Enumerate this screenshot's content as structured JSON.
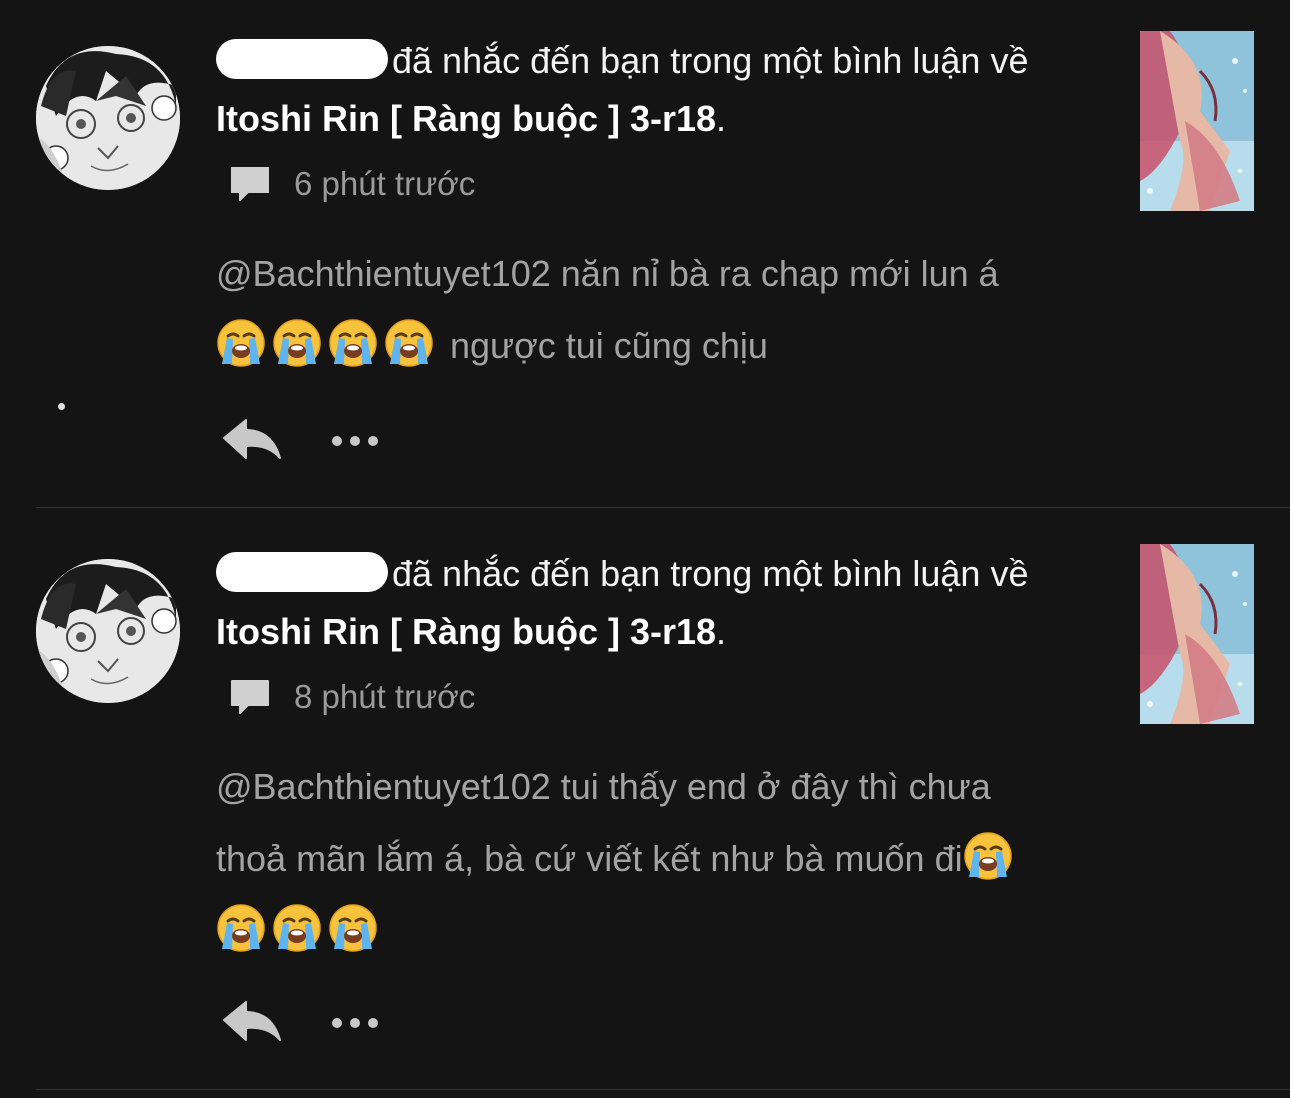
{
  "notifications": [
    {
      "action_text": "đã nhắc đến bạn trong một bình luận về",
      "story_title": "Itoshi Rin [ Ràng buộc ] 3-r18",
      "period": ".",
      "time": "6 phút trước",
      "comment_line1": "@Bachthientuyet102 năn nỉ bà ra chap mới lun á",
      "comment_line2_emojis": [
        "😭",
        "😭",
        "😭",
        "😭"
      ],
      "comment_line2_text": " ngược tui cũng chịu"
    },
    {
      "action_text": "đã nhắc đến bạn trong một bình luận về",
      "story_title": "Itoshi Rin [ Ràng buộc ] 3-r18",
      "period": ".",
      "time": "8 phút trước",
      "comment_line1": "@Bachthientuyet102 tui thấy end ở đây thì chưa",
      "comment_line2": "thoả mãn lắm á, bà cứ viết kết như bà muốn đi",
      "comment_line3_emojis": [
        "😭",
        "😭",
        "😭"
      ]
    }
  ],
  "colors": {
    "background": "#141414",
    "headline": "#f2f2f2",
    "body_text": "#a3a3a3",
    "meta_text": "#9a9a9a",
    "icon": "#d0d0d0",
    "divider": "#333333"
  },
  "icons": {
    "comment": "comment-bubble-icon",
    "reply": "reply-arrow-icon",
    "more": "more-dots-icon",
    "emoji": "loudly-crying-face-emoji"
  }
}
